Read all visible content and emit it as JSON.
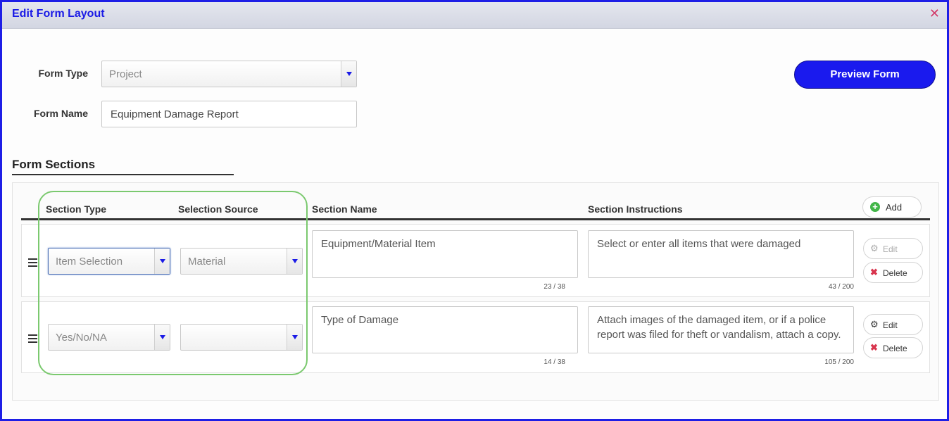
{
  "window": {
    "title": "Edit Form Layout",
    "close_icon": "close-icon"
  },
  "form": {
    "type_label": "Form Type",
    "type_value": "Project",
    "name_label": "Form Name",
    "name_value": "Equipment Damage Report"
  },
  "preview_button": "Preview Form",
  "sections": {
    "title": "Form Sections",
    "headers": {
      "section_type": "Section Type",
      "selection_source": "Selection Source",
      "section_name": "Section Name",
      "section_instructions": "Section Instructions"
    },
    "add_label": "Add",
    "rows": [
      {
        "section_type": "Item Selection",
        "selection_source": "Material",
        "section_name": "Equipment/Material Item",
        "name_count": "23 / 38",
        "instructions": "Select or enter all items that were damaged",
        "instructions_count": "43 / 200",
        "edit_label": "Edit",
        "edit_enabled": false,
        "delete_label": "Delete"
      },
      {
        "section_type": "Yes/No/NA",
        "selection_source": "",
        "section_name": "Type of Damage",
        "name_count": "14 / 38",
        "instructions": "Attach images of the damaged item, or if a police report was filed for theft or vandalism, attach a copy.",
        "instructions_count": "105 / 200",
        "edit_label": "Edit",
        "edit_enabled": true,
        "delete_label": "Delete"
      }
    ]
  },
  "colors": {
    "accent": "#1a1aee",
    "highlight": "#7bc96f",
    "delete": "#d8344d",
    "add": "#43b649"
  }
}
